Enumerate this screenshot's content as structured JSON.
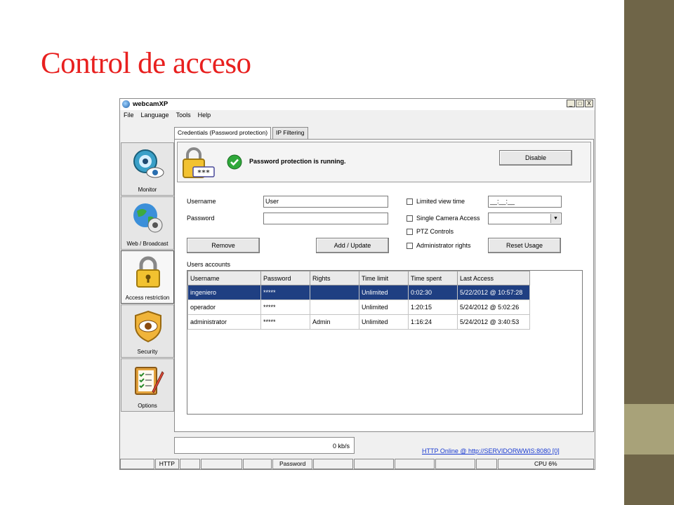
{
  "slide": {
    "title": "Control de acceso"
  },
  "window": {
    "title": "webcamXP",
    "buttons": [
      "_",
      "□",
      "X"
    ],
    "menu": [
      "File",
      "Language",
      "Tools",
      "Help"
    ]
  },
  "sidebar": {
    "items": [
      {
        "label": "Monitor",
        "icon": "webcam-eye-icon"
      },
      {
        "label": "Web / Broadcast",
        "icon": "globe-webcam-icon"
      },
      {
        "label": "Access restriction",
        "icon": "padlock-icon",
        "active": true
      },
      {
        "label": "Security",
        "icon": "shield-eye-icon"
      },
      {
        "label": "Options",
        "icon": "clipboard-checklist-icon"
      }
    ]
  },
  "tabs": [
    {
      "label": "Credentials (Password protection)",
      "active": true
    },
    {
      "label": "IP Filtering"
    }
  ],
  "status": {
    "message": "Password protection is running.",
    "disable_label": "Disable",
    "lock_badge": "***"
  },
  "form": {
    "username_label": "Username",
    "username_value": "User",
    "password_label": "Password",
    "password_value": "",
    "limited_view_time_label": "Limited view time",
    "limited_view_time_value": "__:__:__",
    "single_camera_label": "Single Camera Access",
    "ptz_label": "PTZ Controls",
    "admin_rights_label": "Administrator rights",
    "remove_label": "Remove",
    "add_update_label": "Add / Update",
    "reset_usage_label": "Reset Usage"
  },
  "users": {
    "section_label": "Users accounts",
    "columns": [
      "Username",
      "Password",
      "Rights",
      "Time limit",
      "Time spent",
      "Last Access"
    ],
    "rows": [
      [
        "ingeniero",
        "*****",
        "",
        "Unlimited",
        "0:02:30",
        "5/22/2012 @ 10:57:28"
      ],
      [
        "operador",
        "*****",
        "",
        "Unlimited",
        "1:20:15",
        "5/24/2012 @ 5:02:26"
      ],
      [
        "administrator",
        "*****",
        "Admin",
        "Unlimited",
        "1:16:24",
        "5/24/2012 @ 3:40:53"
      ]
    ]
  },
  "bottom": {
    "rate": "0 kb/s",
    "link": "HTTP Online @ http://SERVIDORWWIS:8080 [0]"
  },
  "statusbar": [
    "",
    "HTTP",
    "",
    "",
    "",
    "Password",
    "",
    "",
    "",
    "",
    "",
    "CPU 6%"
  ],
  "colors": {
    "title_red": "#e8201f",
    "selected_row": "#1f3f82",
    "link_blue": "#1a3bd1",
    "side_bar_dark": "#6f6548",
    "side_bar_light": "#a8a279"
  }
}
